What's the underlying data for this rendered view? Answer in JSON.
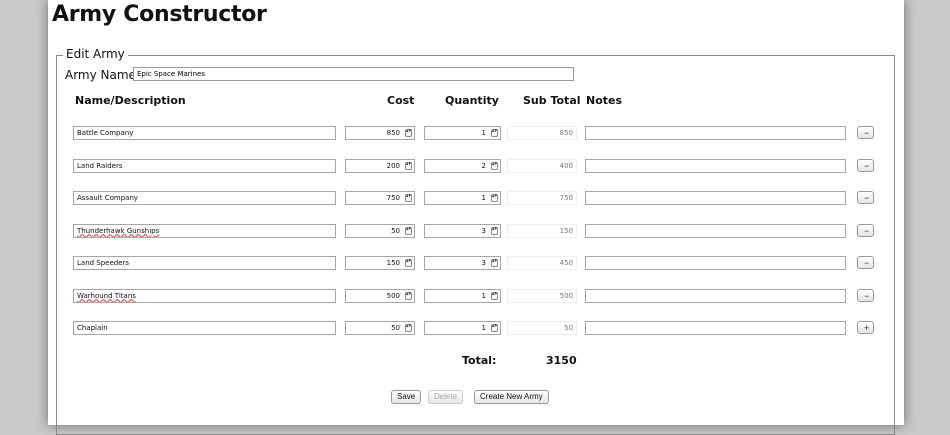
{
  "page": {
    "title": "Army Constructor",
    "fieldset_legend": "Edit Army",
    "army_name_label": "Army Name:",
    "army_name_value": "Epic Space Marines"
  },
  "table": {
    "headers": {
      "name": "Name/Description",
      "cost": "Cost",
      "quantity": "Quantity",
      "subtotal": "Sub Total",
      "notes": "Notes"
    },
    "rows": [
      {
        "name": "Battle Company",
        "cost": "850",
        "qty": "1",
        "sub": "850",
        "notes": "",
        "action": "−"
      },
      {
        "name": "Land Raiders",
        "cost": "200",
        "qty": "2",
        "sub": "400",
        "notes": "",
        "action": "−"
      },
      {
        "name": "Assault Company",
        "cost": "750",
        "qty": "1",
        "sub": "750",
        "notes": "",
        "action": "−"
      },
      {
        "name": "Thunderhawk Gunships",
        "cost": "50",
        "qty": "3",
        "sub": "150",
        "notes": "",
        "action": "−"
      },
      {
        "name": "Land Speeders",
        "cost": "150",
        "qty": "3",
        "sub": "450",
        "notes": "",
        "action": "−"
      },
      {
        "name": "Warhound Titans",
        "cost": "500",
        "qty": "1",
        "sub": "500",
        "notes": "",
        "action": "−"
      },
      {
        "name": "Chaplain",
        "cost": "50",
        "qty": "1",
        "sub": "50",
        "notes": "",
        "action": "+"
      }
    ]
  },
  "totals": {
    "label": "Total:",
    "value": "3150"
  },
  "buttons": {
    "save": "Save",
    "delete": "Delete",
    "create": "Create New Army"
  },
  "spin_glyph": "▴▾"
}
